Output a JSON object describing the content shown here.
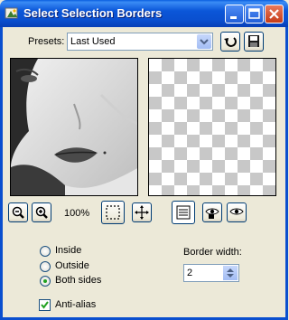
{
  "window": {
    "title": "Select Selection Borders",
    "controls": [
      "minimize-icon",
      "maximize-icon",
      "close-icon"
    ]
  },
  "presets": {
    "label": "Presets:",
    "selected": "Last Used"
  },
  "zoom": {
    "level": "100%"
  },
  "border_options": {
    "inside_label": "Inside",
    "outside_label": "Outside",
    "both_sides_label": "Both sides",
    "selected": "Both sides",
    "anti_alias_label": "Anti-alias",
    "anti_alias_checked": true
  },
  "border_width": {
    "label": "Border width:",
    "value": "2"
  },
  "colors": {
    "title_bar": "#0a4fcf",
    "dialog_bg": "#ece9d8",
    "radio_selected": "#21a121"
  }
}
